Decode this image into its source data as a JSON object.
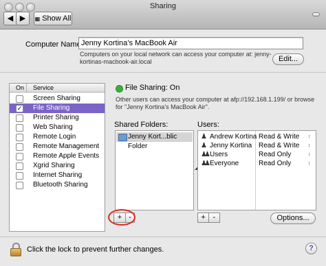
{
  "window": {
    "title": "Sharing"
  },
  "toolbar": {
    "show_all": "Show All"
  },
  "computer": {
    "label": "Computer Name:",
    "value": "Jenny Kortina’s MacBook Air",
    "info_line1": "Computers on your local network can access your computer at: jenny-",
    "info_line2": "kortinas-macbook-air.local",
    "edit_button": "Edit..."
  },
  "services": {
    "col_on": "On",
    "col_service": "Service",
    "items": [
      {
        "label": "Screen Sharing",
        "checked": false,
        "selected": false
      },
      {
        "label": "File Sharing",
        "checked": true,
        "selected": true
      },
      {
        "label": "Printer Sharing",
        "checked": false,
        "selected": false
      },
      {
        "label": "Web Sharing",
        "checked": false,
        "selected": false
      },
      {
        "label": "Remote Login",
        "checked": false,
        "selected": false
      },
      {
        "label": "Remote Management",
        "checked": false,
        "selected": false
      },
      {
        "label": "Remote Apple Events",
        "checked": false,
        "selected": false
      },
      {
        "label": "Xgrid Sharing",
        "checked": false,
        "selected": false
      },
      {
        "label": "Internet Sharing",
        "checked": false,
        "selected": false
      },
      {
        "label": "Bluetooth Sharing",
        "checked": false,
        "selected": false
      }
    ]
  },
  "file_sharing": {
    "status": "File Sharing: On",
    "status_color": "#3cae3c",
    "desc_line1": "Other users can access your computer at afp://192.168.1.199/ or browse",
    "desc_line2": "for \"Jenny Kortina’s MacBook Air\"."
  },
  "shared_folders": {
    "label": "Shared Folders:",
    "items": [
      {
        "name": "Jenny Kort...blic Folder"
      }
    ],
    "add": "+",
    "remove": "-"
  },
  "users": {
    "label": "Users:",
    "items": [
      {
        "name": "Andrew Kortina",
        "permission": "Read & Write",
        "icon": "person-icon"
      },
      {
        "name": "Jenny Kortina",
        "permission": "Read & Write",
        "icon": "person-icon"
      },
      {
        "name": "Users",
        "permission": "Read Only",
        "icon": "group-icon"
      },
      {
        "name": "Everyone",
        "permission": "Read Only",
        "icon": "group-icon"
      }
    ],
    "add": "+",
    "remove": "-",
    "options_button": "Options..."
  },
  "footer": {
    "lock_text": "Click the lock to prevent further changes.",
    "help": "?"
  },
  "accent": {
    "selection": "#7c63c8",
    "annotation_circle": "#e0251b"
  }
}
